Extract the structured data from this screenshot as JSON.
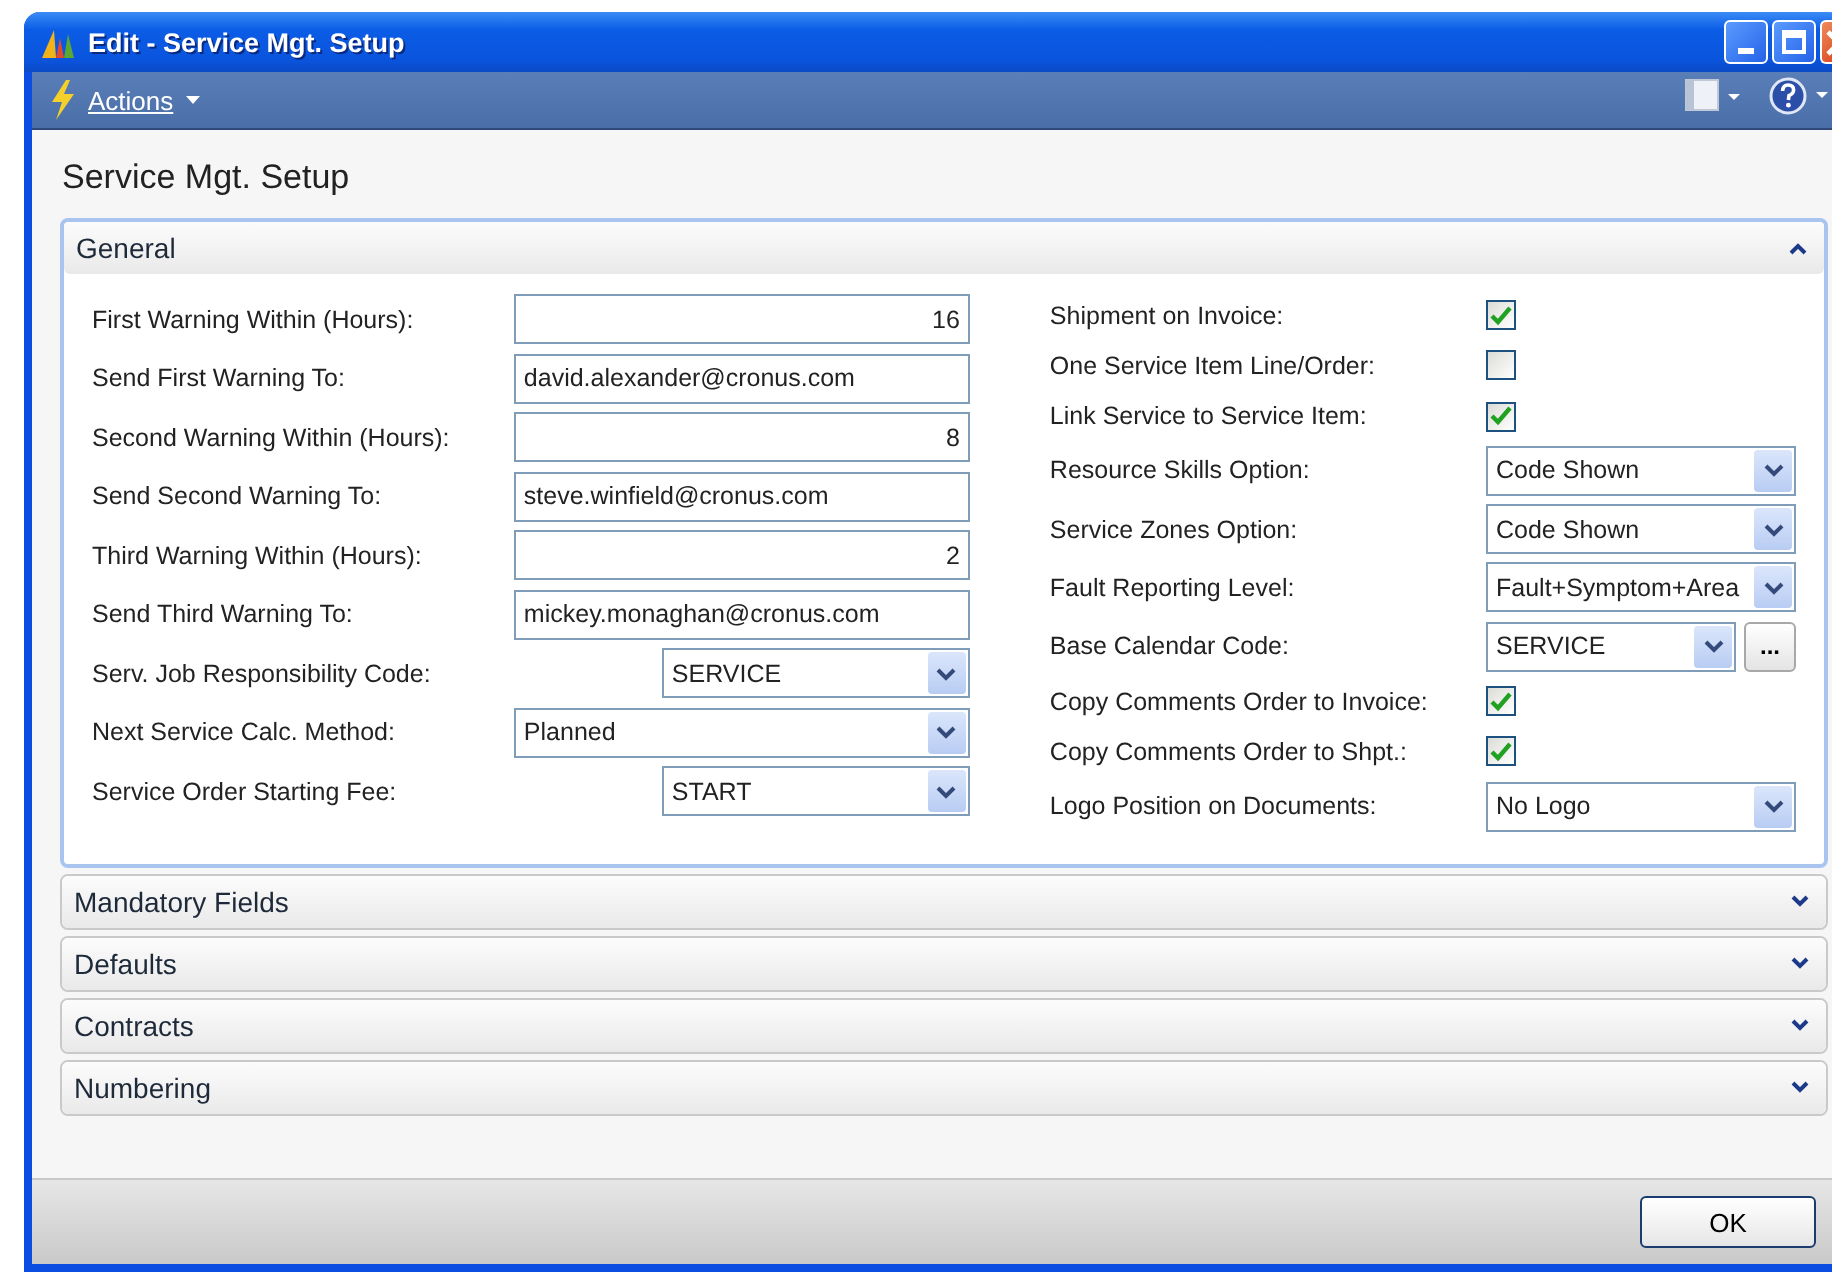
{
  "window": {
    "title": "Edit - Service Mgt. Setup"
  },
  "toolbar": {
    "actions_label": "Actions"
  },
  "page_title": "Service Mgt. Setup",
  "sections": [
    {
      "title": "General",
      "expanded": true,
      "left_fields": [
        {
          "label": "First Warning Within (Hours):",
          "kind": "number",
          "value": "16"
        },
        {
          "label": "Send First Warning To:",
          "kind": "text",
          "value": "david.alexander@cronus.com"
        },
        {
          "label": "Second Warning Within (Hours):",
          "kind": "number",
          "value": "8"
        },
        {
          "label": "Send Second Warning To:",
          "kind": "text",
          "value": "steve.winfield@cronus.com"
        },
        {
          "label": "Third Warning Within (Hours):",
          "kind": "number",
          "value": "2"
        },
        {
          "label": "Send Third Warning To:",
          "kind": "text",
          "value": "mickey.monaghan@cronus.com"
        },
        {
          "label": "Serv. Job Responsibility Code:",
          "kind": "code",
          "value": "SERVICE"
        },
        {
          "label": "Next Service Calc. Method:",
          "kind": "option",
          "value": "Planned"
        },
        {
          "label": "Service Order Starting Fee:",
          "kind": "code",
          "value": "START"
        }
      ],
      "right_fields": [
        {
          "label": "Shipment on Invoice:",
          "kind": "checkbox",
          "checked": true
        },
        {
          "label": "One Service Item Line/Order:",
          "kind": "checkbox",
          "checked": false
        },
        {
          "label": "Link Service to Service Item:",
          "kind": "checkbox",
          "checked": true
        },
        {
          "label": "Resource Skills Option:",
          "kind": "option",
          "value": "Code Shown"
        },
        {
          "label": "Service Zones Option:",
          "kind": "option",
          "value": "Code Shown"
        },
        {
          "label": "Fault Reporting Level:",
          "kind": "option",
          "value": "Fault+Symptom+Area"
        },
        {
          "label": "Base Calendar Code:",
          "kind": "lookup",
          "value": "SERVICE",
          "assist_button": "..."
        },
        {
          "label": "Copy Comments Order to Invoice:",
          "kind": "checkbox",
          "checked": true
        },
        {
          "label": "Copy Comments Order to Shpt.:",
          "kind": "checkbox",
          "checked": true
        },
        {
          "label": "Logo Position on Documents:",
          "kind": "option",
          "value": "No Logo"
        }
      ]
    },
    {
      "title": "Mandatory Fields",
      "expanded": false
    },
    {
      "title": "Defaults",
      "expanded": false
    },
    {
      "title": "Contracts",
      "expanded": false
    },
    {
      "title": "Numbering",
      "expanded": false
    }
  ],
  "ok_button": "OK"
}
